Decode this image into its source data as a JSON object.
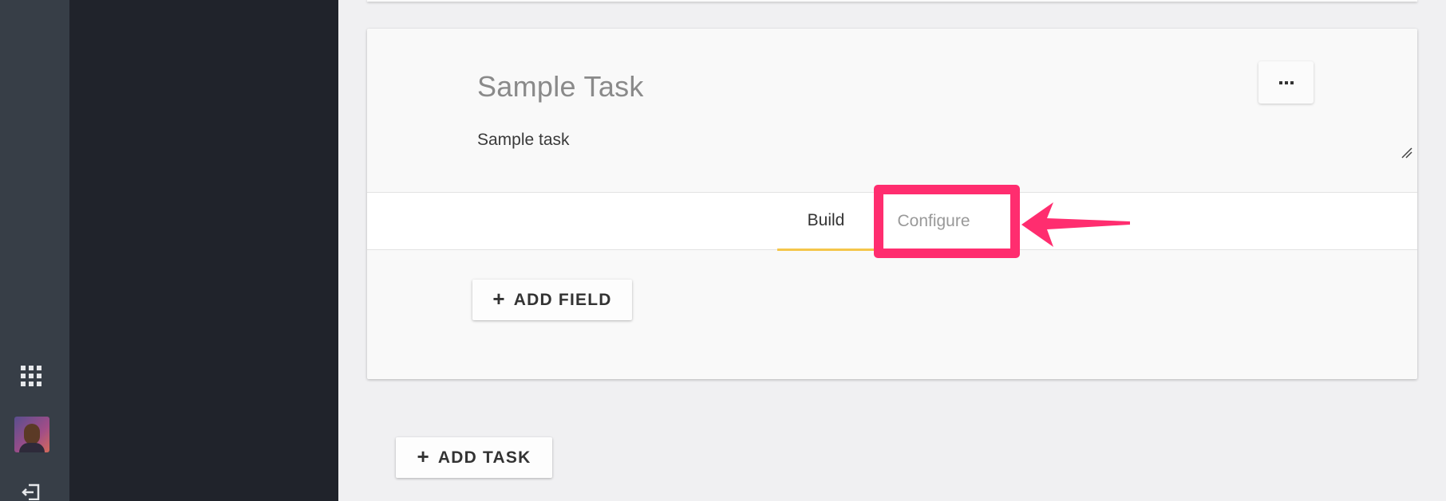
{
  "sidebar": {
    "icons": [
      "apps-grid-icon",
      "avatar",
      "logout-icon"
    ]
  },
  "task": {
    "title": "Sample Task",
    "description": "Sample task",
    "more_label": "..."
  },
  "tabs": [
    {
      "label": "Build",
      "active": true
    },
    {
      "label": "Configure",
      "active": false
    }
  ],
  "buttons": {
    "add_field": "ADD FIELD",
    "add_task": "ADD TASK"
  },
  "colors": {
    "accent_tab": "#f5c64a",
    "annotation": "#ff2d6f"
  }
}
